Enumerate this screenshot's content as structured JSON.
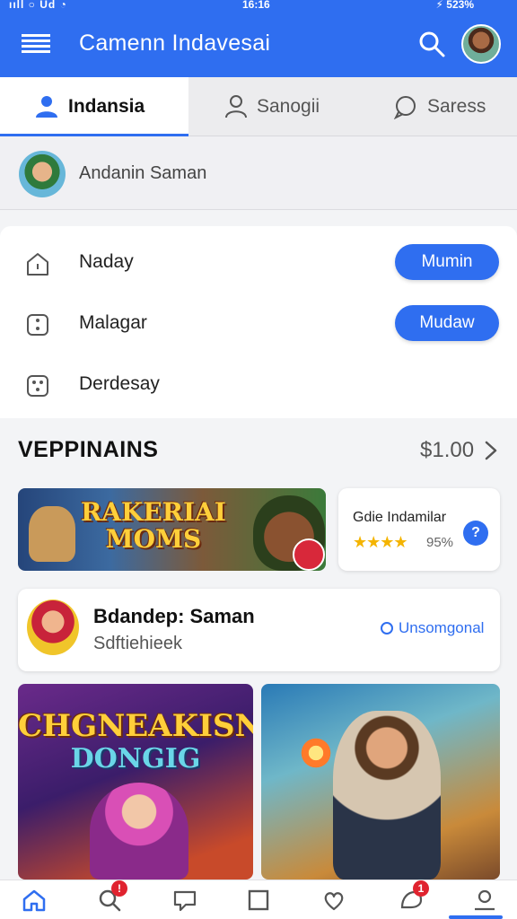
{
  "status_bar": {
    "signal": "ııll ○ Ud ◔",
    "time": "16:16",
    "battery": "⚡ 523%"
  },
  "app_bar": {
    "title": "Camenn Indavesai",
    "accent_color": "#2f6ef0",
    "menu_icon": "hamburger-icon",
    "search_icon": "search-icon"
  },
  "tabs": [
    {
      "label": "Indansia",
      "icon": "person-icon",
      "active": true
    },
    {
      "label": "Sanogii",
      "icon": "person-outline-icon",
      "active": false
    },
    {
      "label": "Saress",
      "icon": "chat-bubble-icon",
      "active": false
    }
  ],
  "profile": {
    "name": "Andanin Saman"
  },
  "list": [
    {
      "label": "Naday",
      "icon": "house-icon",
      "action": "Mumin"
    },
    {
      "label": "Malagar",
      "icon": "dice-icon",
      "action": "Mudaw"
    },
    {
      "label": "Derdesay",
      "icon": "dice-icon",
      "action": null
    }
  ],
  "section": {
    "title": "VEPPINAINS",
    "price": "$1.00"
  },
  "banner": {
    "line1": "RAKERIAI",
    "line2": "MOMS"
  },
  "rating_card": {
    "name": "Gdie Indamilar",
    "stars": "★★★★",
    "percent": "95%",
    "help": "?"
  },
  "user_card": {
    "name": "Bdandep: Saman",
    "subtitle": "Sdftiehieek",
    "link": "Unsomgonal"
  },
  "tiles": {
    "left_line1": "CHGNEAKISN",
    "left_line2": "DONGIG"
  },
  "bottom_nav": [
    {
      "icon": "home-icon",
      "badge": null
    },
    {
      "icon": "search-icon",
      "badge": "!"
    },
    {
      "icon": "message-icon",
      "badge": null
    },
    {
      "icon": "square-icon",
      "badge": null
    },
    {
      "icon": "heart-icon",
      "badge": null
    },
    {
      "icon": "notification-icon",
      "badge": "1"
    },
    {
      "icon": "profile-icon",
      "badge": null
    }
  ]
}
